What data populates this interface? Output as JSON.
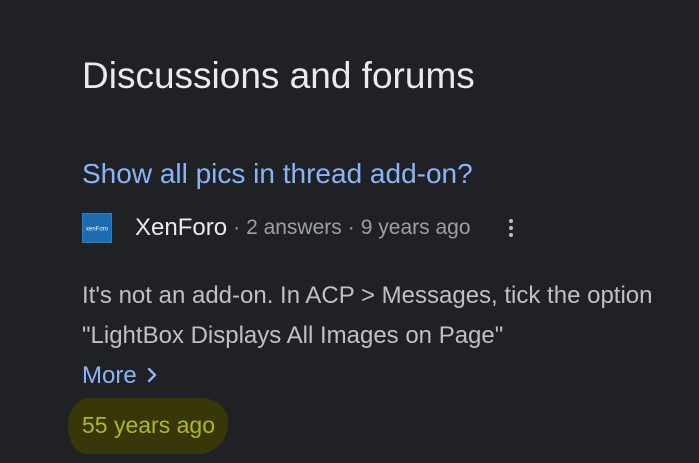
{
  "section": {
    "title": "Discussions and forums"
  },
  "result": {
    "title": "Show all pics in thread add-on?",
    "site_name": "XenForo",
    "logo_text": "xenForo",
    "separator": "·",
    "answers": "2 answers",
    "age": "9 years ago",
    "snippet": "It's not an add-on. In ACP > Messages, tick the option \"LightBox Displays All Images on Page\"",
    "more_label": "More",
    "timestamp": "55 years ago"
  },
  "icons": {
    "logo": "xenforo-logo-icon",
    "menu": "more-vert-icon",
    "chevron": "chevron-right-icon"
  },
  "colors": {
    "background": "#202124",
    "link": "#8ab4f8",
    "highlight": "#3c3b06",
    "timestamp": "#b5b51e"
  }
}
